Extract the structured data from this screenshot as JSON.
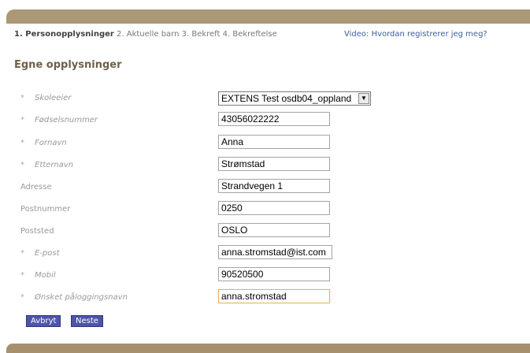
{
  "steps": {
    "step1": "1. Personopplysninger",
    "rest": " 2. Aktuelle barn 3. Bekreft 4. Bekreftelse"
  },
  "video_link": "Video: Hvordan registrerer jeg meg?",
  "section_title": "Egne opplysninger",
  "required_marker": "*",
  "fields": {
    "skoleeier": {
      "label": "Skoleeier",
      "value": "EXTENS Test osdb04_oppland"
    },
    "fodselsnummer": {
      "label": "Fødselsnummer",
      "value": "43056022222"
    },
    "fornavn": {
      "label": "Fornavn",
      "value": "Anna"
    },
    "etternavn": {
      "label": "Etternavn",
      "value": "Strømstad"
    },
    "adresse": {
      "label": "Adresse",
      "value": "Strandvegen 1"
    },
    "postnummer": {
      "label": "Postnummer",
      "value": "0250"
    },
    "poststed": {
      "label": "Poststed",
      "value": "OSLO"
    },
    "epost": {
      "label": "E-post",
      "value": "anna.stromstad@ist.com"
    },
    "mobil": {
      "label": "Mobil",
      "value": "90520500"
    },
    "brukernavn": {
      "label": "Ønsket påloggingsnavn",
      "value": "anna.stromstad"
    }
  },
  "buttons": {
    "cancel": "Avbryt",
    "next": "Neste"
  },
  "colors": {
    "header_bar": "#ab9876",
    "button": "#4e54a8",
    "title": "#6e6049",
    "link": "#3b5f9e"
  }
}
